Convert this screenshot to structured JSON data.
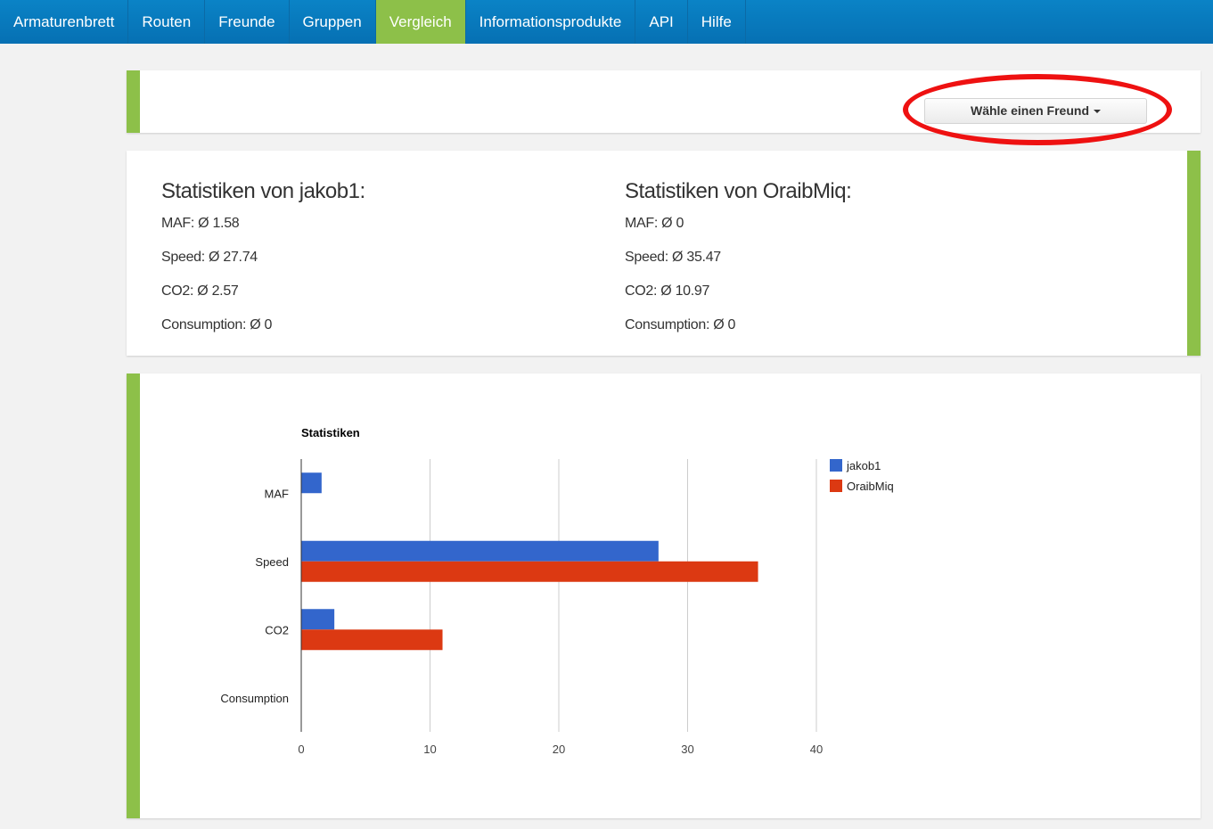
{
  "nav": {
    "items": [
      {
        "label": "Armaturenbrett",
        "active": false
      },
      {
        "label": "Routen",
        "active": false
      },
      {
        "label": "Freunde",
        "active": false
      },
      {
        "label": "Gruppen",
        "active": false
      },
      {
        "label": "Vergleich",
        "active": true
      },
      {
        "label": "Informationsprodukte",
        "active": false
      },
      {
        "label": "API",
        "active": false
      },
      {
        "label": "Hilfe",
        "active": false
      }
    ]
  },
  "friend_select": {
    "label": "Wähle einen Freund"
  },
  "stats": {
    "left": {
      "title": "Statistiken von jakob1:",
      "lines": [
        "MAF: Ø 1.58",
        "Speed: Ø 27.74",
        "CO2: Ø 2.57",
        "Consumption: Ø 0"
      ]
    },
    "right": {
      "title": "Statistiken von OraibMiq:",
      "lines": [
        "MAF: Ø 0",
        "Speed: Ø 35.47",
        "CO2: Ø 10.97",
        "Consumption: Ø 0"
      ]
    }
  },
  "colors": {
    "nav_bg": "#0a7bbf",
    "accent_green": "#8dc049",
    "series_blue": "#3366cc",
    "series_red": "#dc3912",
    "highlight_red": "#ee1111"
  },
  "chart_data": {
    "type": "bar",
    "orientation": "horizontal",
    "title": "Statistiken",
    "categories": [
      "MAF",
      "Speed",
      "CO2",
      "Consumption"
    ],
    "series": [
      {
        "name": "jakob1",
        "color": "#3366cc",
        "values": [
          1.58,
          27.74,
          2.57,
          0
        ]
      },
      {
        "name": "OraibMiq",
        "color": "#dc3912",
        "values": [
          0,
          35.47,
          10.97,
          0
        ]
      }
    ],
    "xlim": [
      0,
      40
    ],
    "xticks": [
      "0",
      "10",
      "20",
      "30",
      "40"
    ],
    "grid": true,
    "legend": "right"
  }
}
